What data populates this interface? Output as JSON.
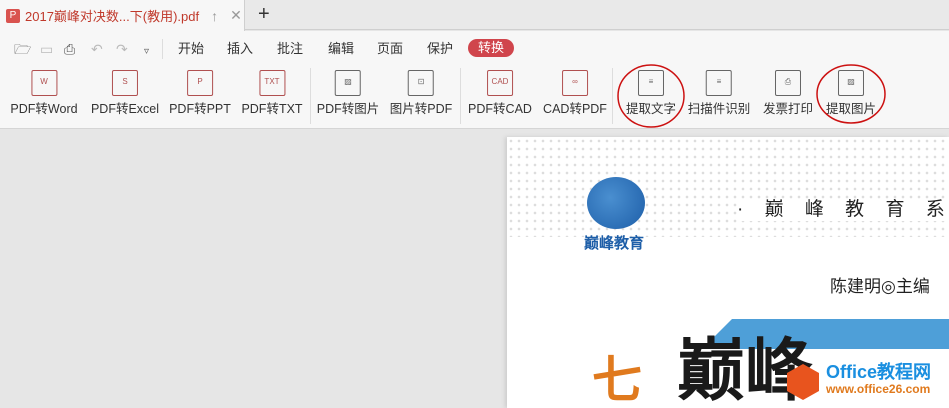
{
  "tab": {
    "title": "2017巅峰对决数...下(教用).pdf",
    "icon": "pdf-icon"
  },
  "quick_icons": [
    "open-folder-icon",
    "save-icon",
    "print-icon",
    "undo-icon",
    "redo-icon",
    "more-dropdown-icon"
  ],
  "menu": [
    "开始",
    "插入",
    "批注",
    "编辑",
    "页面",
    "保护",
    "转换"
  ],
  "tools": [
    {
      "label": "PDF转Word",
      "glyph": "W"
    },
    {
      "label": "PDF转Excel",
      "glyph": "S"
    },
    {
      "label": "PDF转PPT",
      "glyph": "P"
    },
    {
      "label": "PDF转TXT",
      "glyph": "TXT"
    },
    {
      "label": "PDF转图片",
      "glyph": "▨"
    },
    {
      "label": "图片转PDF",
      "glyph": "⊡"
    },
    {
      "label": "PDF转CAD",
      "glyph": "CAD"
    },
    {
      "label": "CAD转PDF",
      "glyph": "∞"
    },
    {
      "label": "提取文字",
      "glyph": "≡"
    },
    {
      "label": "扫描件识别",
      "glyph": "≡"
    },
    {
      "label": "发票打印",
      "glyph": "⎙"
    },
    {
      "label": "提取图片",
      "glyph": "▨"
    }
  ],
  "document": {
    "logo_text": "巅峰教育",
    "series": "· 巅 峰 教 育 系 列",
    "editor": "陈建明◎主编",
    "title_char1": "七",
    "title_chars": "巅峰"
  },
  "watermark": {
    "line1": "Office教程网",
    "line2": "www.office26.com"
  },
  "colors": {
    "accent": "#d0454c",
    "annotation": "#cc1111"
  }
}
